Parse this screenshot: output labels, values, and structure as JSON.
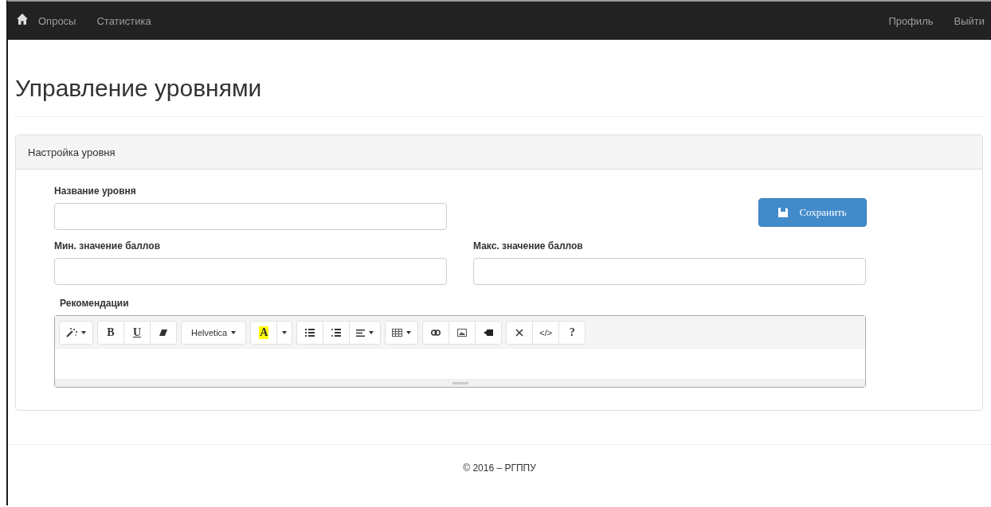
{
  "navbar": {
    "left": [
      {
        "label": "Опросы"
      },
      {
        "label": "Статистика"
      }
    ],
    "right": [
      {
        "label": "Профиль"
      },
      {
        "label": "Выйти"
      }
    ]
  },
  "page_title": "Управление уровнями",
  "panel": {
    "heading": "Настройка уровня",
    "fields": [
      {
        "label": "Название уровня"
      },
      {
        "label": "Мин. значение баллов"
      },
      {
        "label": "Макс. значение баллов"
      }
    ],
    "save_button": "Сохранить",
    "editor": {
      "label": "Рекомендации",
      "toolbar": [
        [
          {
            "kind": "wand",
            "dropdown": true
          }
        ],
        [
          {
            "kind": "text",
            "label": "B",
            "dropdown": false
          },
          {
            "kind": "text",
            "label": "U",
            "dropdown": false
          },
          {
            "kind": "eraser",
            "dropdown": false
          }
        ],
        [
          {
            "kind": "text",
            "label": "Helvetica",
            "dropdown": true
          }
        ],
        [
          {
            "kind": "text",
            "label": "A",
            "dropdown": false
          },
          {
            "kind": "caret",
            "dropdown": true
          }
        ],
        [
          {
            "kind": "ul",
            "dropdown": false
          },
          {
            "kind": "ol",
            "dropdown": false
          },
          {
            "kind": "align",
            "dropdown": true
          }
        ],
        [
          {
            "kind": "table",
            "dropdown": true
          }
        ],
        [
          {
            "kind": "link",
            "dropdown": false
          },
          {
            "kind": "image",
            "dropdown": false
          },
          {
            "kind": "video",
            "dropdown": false
          }
        ],
        [
          {
            "kind": "fullscreen",
            "dropdown": false
          },
          {
            "kind": "text",
            "label": "</>",
            "dropdown": false
          },
          {
            "kind": "text",
            "label": "?",
            "dropdown": false
          }
        ]
      ]
    }
  },
  "footer": "© 2016 – РГППУ"
}
